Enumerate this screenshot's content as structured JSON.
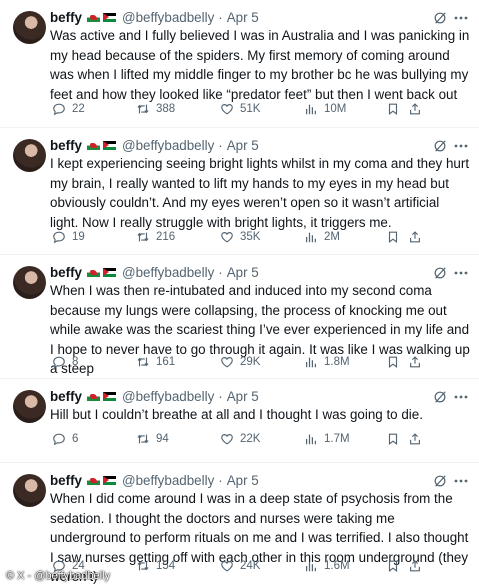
{
  "tweets": [
    {
      "name": "beffy",
      "handle": "@beffybadbelly",
      "dot": "·",
      "date": "Apr 5",
      "text": "Was active and I fully believed I was in Australia and I was panicking in my head because of the spiders. My first memory of coming around was when I lifted my middle finger to my brother bc he was bullying my feet and how they looked like “predator feet” but then I went back out",
      "replies": "22",
      "retweets": "388",
      "likes": "51K",
      "views": "10M"
    },
    {
      "name": "beffy",
      "handle": "@beffybadbelly",
      "dot": "·",
      "date": "Apr 5",
      "text": "I kept experiencing seeing bright lights whilst in my coma and they hurt my brain, I really wanted to lift my hands to my eyes in my head but obviously couldn’t. And my eyes weren’t open so it wasn’t artificial light. Now I really struggle with bright lights, it triggers me.",
      "replies": "19",
      "retweets": "216",
      "likes": "35K",
      "views": "2M"
    },
    {
      "name": "beffy",
      "handle": "@beffybadbelly",
      "dot": "·",
      "date": "Apr 5",
      "text": "When I was then re-intubated and induced into my second coma because my lungs were collapsing, the process of knocking me out while awake was the scariest thing I’ve ever experienced in my life and I hope to never have to go through it again. It was like I was walking up a steep",
      "replies": "8",
      "retweets": "161",
      "likes": "29K",
      "views": "1.8M"
    },
    {
      "name": "beffy",
      "handle": "@beffybadbelly",
      "dot": "·",
      "date": "Apr 5",
      "text": "Hill but I couldn’t breathe at all and I thought I was going to die.",
      "replies": "6",
      "retweets": "94",
      "likes": "22K",
      "views": "1.7M"
    },
    {
      "name": "beffy",
      "handle": "@beffybadbelly",
      "dot": "·",
      "date": "Apr 5",
      "text": "When I did come around I was in a deep state of psychosis from the sedation. I thought the doctors and nurses were taking me underground to perform rituals on me and I was terrified. I also thought I saw nurses getting off with each other in this room underground (they weren’t)",
      "replies": "24",
      "retweets": "154",
      "likes": "24K",
      "views": "1.6M"
    }
  ],
  "watermark": "© X - @beffybadbelly",
  "colors": {
    "text": "#0f1419",
    "muted": "#536471",
    "divider": "#eff3f4"
  }
}
